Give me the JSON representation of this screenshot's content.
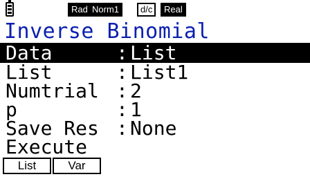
{
  "status_bar": {
    "battery_icon": "battery-icon",
    "angle_mode": "Rad",
    "display_mode": "Norm1",
    "fraction_mode": "d/c",
    "complex_mode": "Real"
  },
  "title": "Inverse Binomial",
  "rows": [
    {
      "label": "Data",
      "value": "List",
      "selected": true
    },
    {
      "label": "List",
      "value": "List1"
    },
    {
      "label": "Numtrial",
      "value": "2"
    },
    {
      "label": "p",
      "value": "1"
    },
    {
      "label": "Save Res",
      "value": "None"
    },
    {
      "label": "Execute",
      "value": ""
    }
  ],
  "separator": ":",
  "function_keys": [
    "List",
    "Var"
  ],
  "colors": {
    "title": "#0a1fb0",
    "selection": "#000000"
  }
}
